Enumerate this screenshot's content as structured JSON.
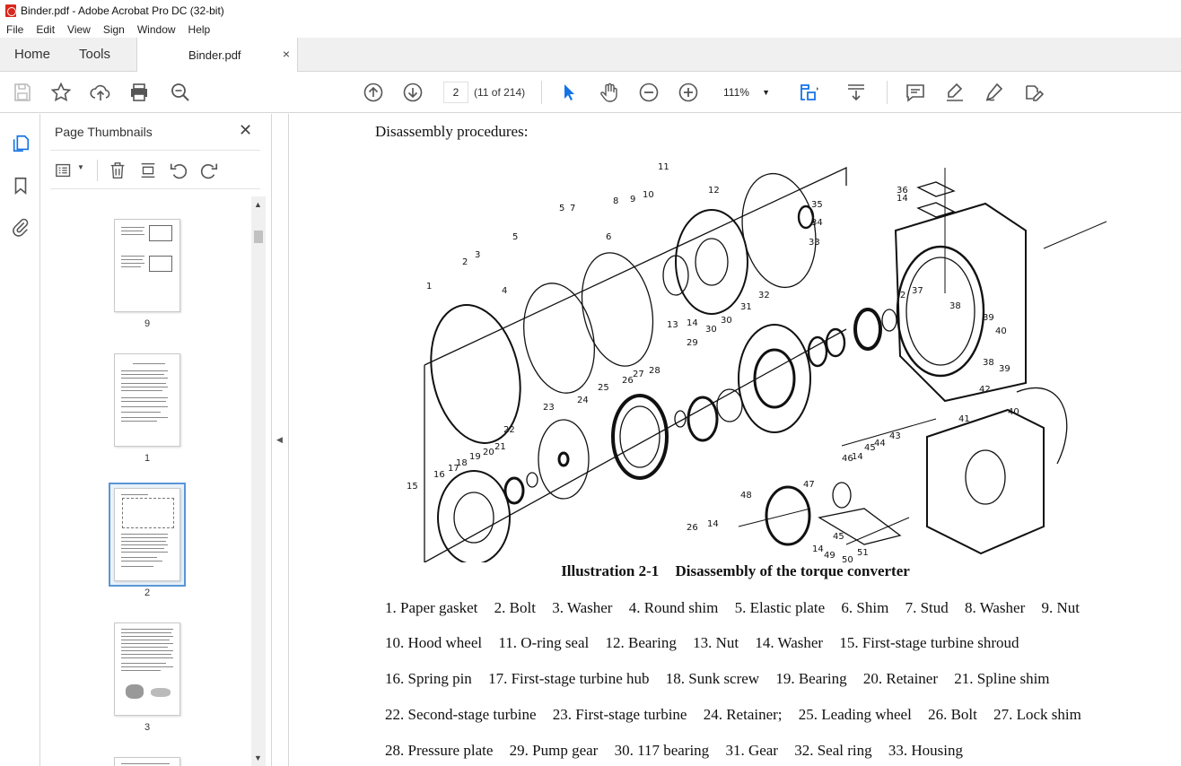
{
  "window": {
    "title": "Binder.pdf - Adobe Acrobat Pro DC (32-bit)"
  },
  "menu": [
    "File",
    "Edit",
    "View",
    "Sign",
    "Window",
    "Help"
  ],
  "tabs": {
    "home": "Home",
    "tools": "Tools",
    "document": "Binder.pdf",
    "close": "×"
  },
  "toolbar": {
    "page_input": "2",
    "page_count": "(11 of 214)",
    "zoom": "111%",
    "icons": [
      "save-icon",
      "star-icon",
      "upload-icon",
      "print-icon",
      "search-zoom-icon",
      "prev-page-icon",
      "next-page-icon",
      "select-cursor-icon",
      "hand-icon",
      "zoom-out-icon",
      "zoom-in-icon",
      "fit-page-icon",
      "scroll-mode-icon",
      "comment-icon",
      "highlight-icon",
      "sign-icon",
      "fill-sign-icon"
    ]
  },
  "sidebar": {
    "title": "Page Thumbnails",
    "close": "✕",
    "thumbnails": [
      {
        "label": "9",
        "selected": false
      },
      {
        "label": "1",
        "selected": false
      },
      {
        "label": "2",
        "selected": true
      },
      {
        "label": "3",
        "selected": false
      }
    ]
  },
  "document": {
    "heading": "Disassembly procedures:",
    "caption_number": "Illustration 2-1",
    "caption_title": "Disassembly of the torque converter",
    "diagram_callouts": [
      "1",
      "2",
      "3",
      "4",
      "5",
      "5",
      "6",
      "7",
      "8",
      "9",
      "10",
      "11",
      "12",
      "13",
      "14",
      "15",
      "16",
      "17",
      "18",
      "19",
      "20",
      "21",
      "22",
      "23",
      "24",
      "25",
      "26",
      "27",
      "28",
      "29",
      "30",
      "30",
      "31",
      "32",
      "33",
      "34",
      "35",
      "36",
      "14",
      "37",
      "2",
      "38",
      "39",
      "40",
      "38",
      "39",
      "40",
      "41",
      "42",
      "43",
      "44",
      "45",
      "14",
      "46",
      "47",
      "48",
      "26",
      "14",
      "45",
      "14",
      "49",
      "50",
      "51"
    ],
    "legend": [
      [
        "1. Paper gasket",
        "2. Bolt",
        "3. Washer",
        "4. Round shim",
        "5. Elastic plate",
        "6. Shim",
        "7. Stud",
        "8. Washer",
        "9. Nut"
      ],
      [
        "10. Hood wheel",
        "11. O-ring seal",
        "12. Bearing",
        "13. Nut",
        "14. Washer",
        "15. First-stage turbine shroud"
      ],
      [
        "16. Spring pin",
        "17. First-stage turbine hub",
        "18. Sunk screw",
        "19. Bearing",
        "20. Retainer",
        "21. Spline shim"
      ],
      [
        "22. Second-stage turbine",
        "23. First-stage turbine",
        "24. Retainer;",
        "25. Leading wheel",
        "26. Bolt",
        "27. Lock shim"
      ],
      [
        "28. Pressure plate",
        "29. Pump gear",
        "30. 117 bearing",
        "31. Gear",
        "32. Seal ring",
        "33. Housing"
      ]
    ]
  },
  "colors": {
    "accent": "#1473e6",
    "selection": "#5a95d6",
    "pdf_red": "#d9271c"
  }
}
